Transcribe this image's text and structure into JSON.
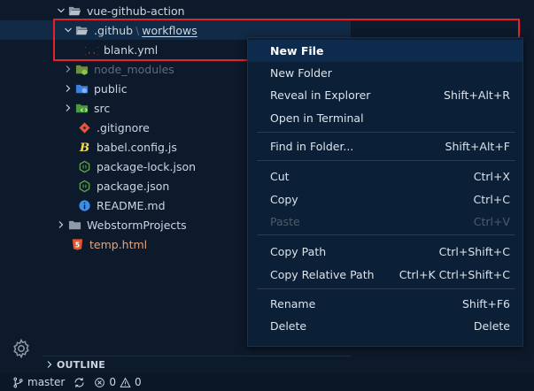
{
  "explorer": {
    "items": [
      {
        "label": "vue-github-action",
        "type": "folder-open"
      },
      {
        "label": ".github",
        "type": "folder-open",
        "separator": "\\",
        "sub_label": "workflows"
      },
      {
        "label": "blank.yml",
        "type": "yaml"
      },
      {
        "label": "node_modules",
        "type": "folder-node"
      },
      {
        "label": "public",
        "type": "folder-public"
      },
      {
        "label": "src",
        "type": "folder-src"
      },
      {
        "label": ".gitignore",
        "type": "git"
      },
      {
        "label": "babel.config.js",
        "type": "babel"
      },
      {
        "label": "package-lock.json",
        "type": "npm"
      },
      {
        "label": "package.json",
        "type": "npm"
      },
      {
        "label": "README.md",
        "type": "info"
      },
      {
        "label": "WebstormProjects",
        "type": "folder"
      },
      {
        "label": "temp.html",
        "type": "html"
      }
    ]
  },
  "context_menu": {
    "items": [
      {
        "label": "New File",
        "shortcut": ""
      },
      {
        "label": "New Folder",
        "shortcut": ""
      },
      {
        "label": "Reveal in Explorer",
        "shortcut": "Shift+Alt+R"
      },
      {
        "label": "Open in Terminal",
        "shortcut": ""
      },
      {
        "label": "Find in Folder...",
        "shortcut": "Shift+Alt+F"
      },
      {
        "label": "Cut",
        "shortcut": "Ctrl+X"
      },
      {
        "label": "Copy",
        "shortcut": "Ctrl+C"
      },
      {
        "label": "Paste",
        "shortcut": "Ctrl+V"
      },
      {
        "label": "Copy Path",
        "shortcut": "Ctrl+Shift+C"
      },
      {
        "label": "Copy Relative Path",
        "shortcut": "Ctrl+K Ctrl+Shift+C"
      },
      {
        "label": "Rename",
        "shortcut": "Shift+F6"
      },
      {
        "label": "Delete",
        "shortcut": "Delete"
      }
    ]
  },
  "outline": {
    "label": "OUTLINE"
  },
  "statusbar": {
    "branch": "master",
    "errors": "0",
    "warnings": "0"
  },
  "colors": {
    "background": "#0d1a2b",
    "highlight_border": "#e5222b",
    "menu_background": "#0b1f36",
    "menu_active": "#0d2c4d",
    "status_bar": "#0b1727"
  }
}
